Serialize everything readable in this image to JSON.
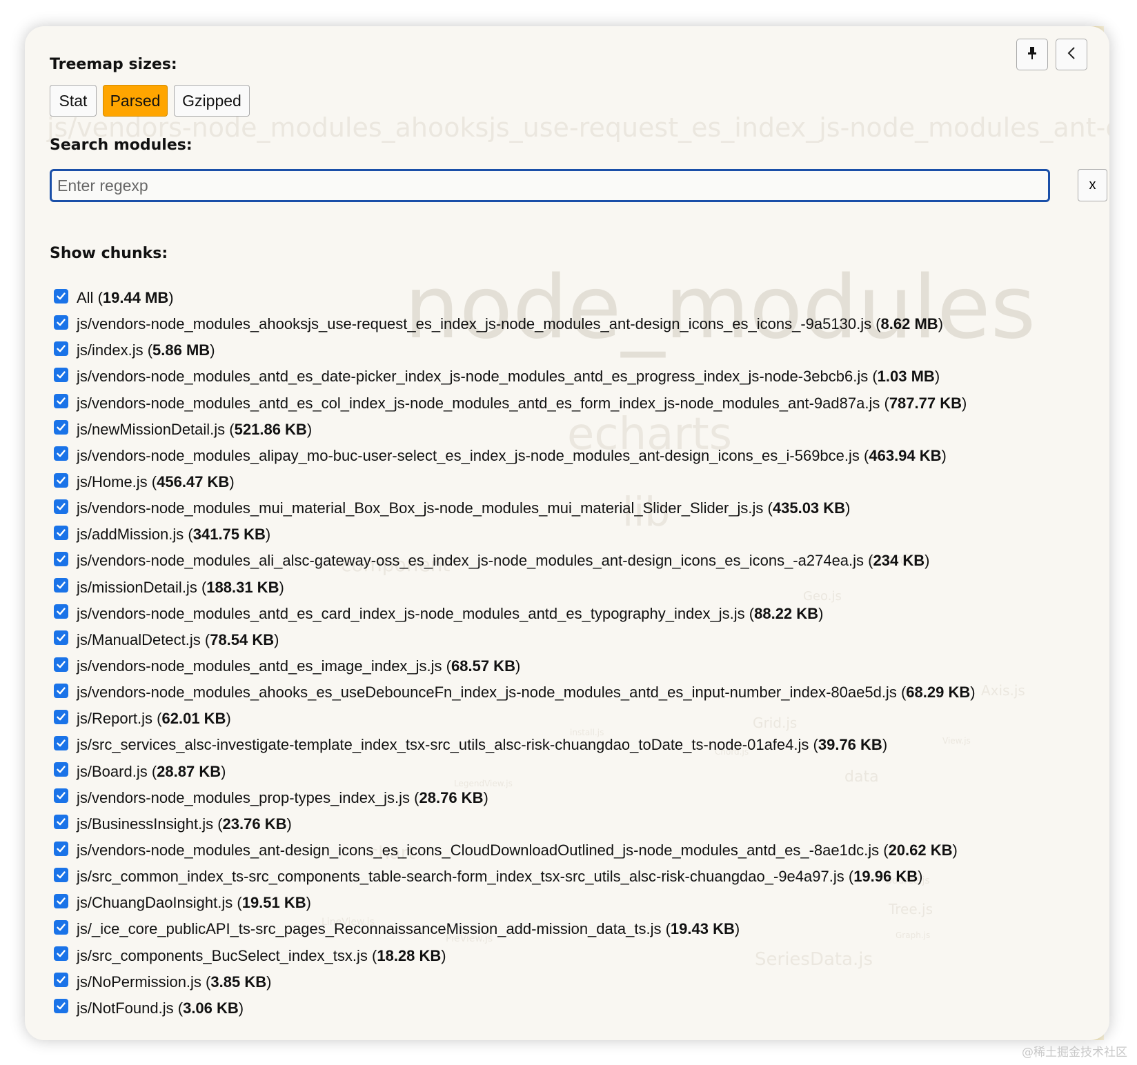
{
  "treemap": {
    "title": "Treemap sizes:",
    "options": [
      {
        "label": "Stat",
        "active": false
      },
      {
        "label": "Parsed",
        "active": true
      },
      {
        "label": "Gzipped",
        "active": false
      }
    ]
  },
  "search": {
    "title": "Search modules:",
    "placeholder": "Enter regexp",
    "clear_label": "x"
  },
  "chunks": {
    "title": "Show chunks:",
    "items": [
      {
        "name": "All",
        "size": "19.44 MB",
        "checked": true
      },
      {
        "name": "js/vendors-node_modules_ahooksjs_use-request_es_index_js-node_modules_ant-design_icons_es_icons_-9a5130.js",
        "size": "8.62 MB",
        "checked": true
      },
      {
        "name": "js/index.js",
        "size": "5.86 MB",
        "checked": true
      },
      {
        "name": "js/vendors-node_modules_antd_es_date-picker_index_js-node_modules_antd_es_progress_index_js-node-3ebcb6.js",
        "size": "1.03 MB",
        "checked": true
      },
      {
        "name": "js/vendors-node_modules_antd_es_col_index_js-node_modules_antd_es_form_index_js-node_modules_ant-9ad87a.js",
        "size": "787.77 KB",
        "checked": true
      },
      {
        "name": "js/newMissionDetail.js",
        "size": "521.86 KB",
        "checked": true
      },
      {
        "name": "js/vendors-node_modules_alipay_mo-buc-user-select_es_index_js-node_modules_ant-design_icons_es_i-569bce.js",
        "size": "463.94 KB",
        "checked": true
      },
      {
        "name": "js/Home.js",
        "size": "456.47 KB",
        "checked": true
      },
      {
        "name": "js/vendors-node_modules_mui_material_Box_Box_js-node_modules_mui_material_Slider_Slider_js.js",
        "size": "435.03 KB",
        "checked": true
      },
      {
        "name": "js/addMission.js",
        "size": "341.75 KB",
        "checked": true
      },
      {
        "name": "js/vendors-node_modules_ali_alsc-gateway-oss_es_index_js-node_modules_ant-design_icons_es_icons_-a274ea.js",
        "size": "234 KB",
        "checked": true
      },
      {
        "name": "js/missionDetail.js",
        "size": "188.31 KB",
        "checked": true
      },
      {
        "name": "js/vendors-node_modules_antd_es_card_index_js-node_modules_antd_es_typography_index_js.js",
        "size": "88.22 KB",
        "checked": true
      },
      {
        "name": "js/ManualDetect.js",
        "size": "78.54 KB",
        "checked": true
      },
      {
        "name": "js/vendors-node_modules_antd_es_image_index_js.js",
        "size": "68.57 KB",
        "checked": true
      },
      {
        "name": "js/vendors-node_modules_ahooks_es_useDebounceFn_index_js-node_modules_antd_es_input-number_index-80ae5d.js",
        "size": "68.29 KB",
        "checked": true
      },
      {
        "name": "js/Report.js",
        "size": "62.01 KB",
        "checked": true
      },
      {
        "name": "js/src_services_alsc-investigate-template_index_tsx-src_utils_alsc-risk-chuangdao_toDate_ts-node-01afe4.js",
        "size": "39.76 KB",
        "checked": true
      },
      {
        "name": "js/Board.js",
        "size": "28.87 KB",
        "checked": true
      },
      {
        "name": "js/vendors-node_modules_prop-types_index_js.js",
        "size": "28.76 KB",
        "checked": true
      },
      {
        "name": "js/BusinessInsight.js",
        "size": "23.76 KB",
        "checked": true
      },
      {
        "name": "js/vendors-node_modules_ant-design_icons_es_icons_CloudDownloadOutlined_js-node_modules_antd_es_-8ae1dc.js",
        "size": "20.62 KB",
        "checked": true
      },
      {
        "name": "js/src_common_index_ts-src_components_table-search-form_index_tsx-src_utils_alsc-risk-chuangdao_-9e4a97.js",
        "size": "19.96 KB",
        "checked": true
      },
      {
        "name": "js/ChuangDaoInsight.js",
        "size": "19.51 KB",
        "checked": true
      },
      {
        "name": "js/_ice_core_publicAPI_ts-src_pages_ReconnaissanceMission_add-mission_data_ts.js",
        "size": "19.43 KB",
        "checked": true
      },
      {
        "name": "js/src_components_BucSelect_index_tsx.js",
        "size": "18.28 KB",
        "checked": true
      },
      {
        "name": "js/NoPermission.js",
        "size": "3.85 KB",
        "checked": true
      },
      {
        "name": "js/NotFound.js",
        "size": "3.06 KB",
        "checked": true
      }
    ]
  },
  "treemap_background": [
    "js/vendors-node_modules_ahooksjs_use-request_es_index_js-node_modules_ant-d",
    "node_modules",
    "echarts",
    "lib",
    "component",
    "coord",
    "Geo.js",
    "chart",
    "data",
    "Axis.js",
    "Grid.js",
    "Tree.js",
    "SeriesData.js",
    "LineView.js",
    "PieView.js",
    "Source.js",
    "Graph.js",
    "install.js",
    "LegendView.js",
    "Chord.js",
    "Pie.js",
    "View.js"
  ],
  "watermark": "@稀土掘金技术社区",
  "colors": {
    "accent_active": "#ffa500",
    "checkbox": "#1a73e8",
    "input_border": "#1a4fa8",
    "panel_bg": "#f9f7f2"
  },
  "icons": {
    "pin_button": "pin-icon",
    "collapse_button": "chevron-left-icon"
  }
}
